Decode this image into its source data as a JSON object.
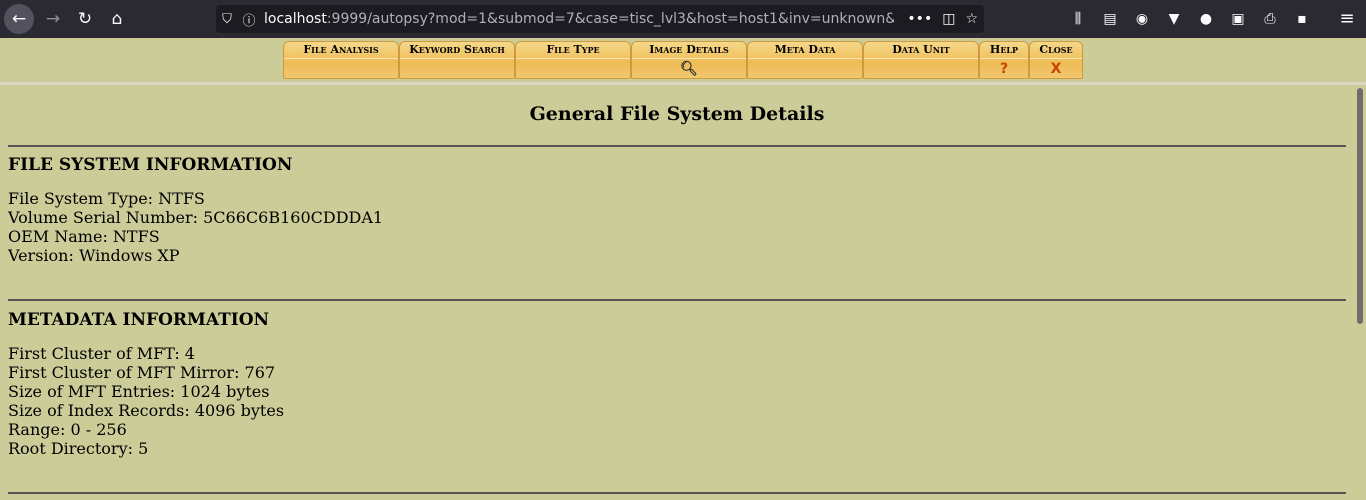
{
  "browser": {
    "url_host": "localhost",
    "url_rest": ":9999/autopsy?mod=1&submod=7&case=tisc_lvl3&host=host1&inv=unknown&"
  },
  "tabs": [
    {
      "label": "File Analysis",
      "sub": ""
    },
    {
      "label": "Keyword Search",
      "sub": ""
    },
    {
      "label": "File Type",
      "sub": ""
    },
    {
      "label": "Image Details",
      "sub": ""
    },
    {
      "label": "Meta Data",
      "sub": ""
    },
    {
      "label": "Data Unit",
      "sub": ""
    },
    {
      "label": "Help",
      "sub": "?"
    },
    {
      "label": "Close",
      "sub": "X"
    }
  ],
  "page": {
    "title": "General File System Details",
    "fs_section": {
      "title": "FILE SYSTEM INFORMATION",
      "fields": [
        "File System Type: NTFS",
        "Volume Serial Number: 5C66C6B160CDDDA1",
        "OEM Name: NTFS",
        "Version: Windows XP"
      ]
    },
    "meta_section": {
      "title": "METADATA INFORMATION",
      "fields": [
        "First Cluster of MFT: 4",
        "First Cluster of MFT Mirror: 767",
        "Size of MFT Entries: 1024 bytes",
        "Size of Index Records: 4096 bytes",
        "Range: 0 - 256",
        "Root Directory: 5"
      ]
    }
  },
  "colors": {
    "page_bg": "#cccc99",
    "tab_fill": "#eebb55",
    "accent_glyph": "#cc4400"
  }
}
